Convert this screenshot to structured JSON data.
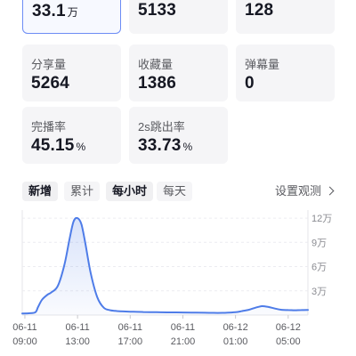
{
  "stats": {
    "top_row": [
      {
        "value": "33.1",
        "unit": "万"
      },
      {
        "value": "5133",
        "unit": ""
      },
      {
        "value": "128",
        "unit": ""
      }
    ],
    "row2": [
      {
        "label": "分享量",
        "value": "5264",
        "unit": ""
      },
      {
        "label": "收藏量",
        "value": "1386",
        "unit": ""
      },
      {
        "label": "弹幕量",
        "value": "0",
        "unit": ""
      }
    ],
    "row3": [
      {
        "label": "完播率",
        "value": "45.15",
        "unit": "%"
      },
      {
        "label": "2s跳出率",
        "value": "33.73",
        "unit": "%"
      }
    ]
  },
  "tabs": {
    "metric": [
      {
        "label": "新增",
        "active": true
      },
      {
        "label": "累计",
        "active": false
      }
    ],
    "granularity": [
      {
        "label": "每小时",
        "active": true
      },
      {
        "label": "每天",
        "active": false
      }
    ]
  },
  "settings_link": "设置观测",
  "colors": {
    "accent": "#4e7ce8",
    "selected_border": "#6c8cf5",
    "card_bg": "#f5f5f7"
  },
  "chart_data": {
    "type": "area",
    "y_ticks": [
      "12万",
      "9万",
      "6万",
      "3万"
    ],
    "y_tick_values": [
      120000,
      90000,
      60000,
      30000
    ],
    "ylim": [
      0,
      130000
    ],
    "x_tick_labels": [
      [
        "06-11",
        "09:00"
      ],
      [
        "06-11",
        "13:00"
      ],
      [
        "06-11",
        "17:00"
      ],
      [
        "06-11",
        "21:00"
      ],
      [
        "06-12",
        "01:00"
      ],
      [
        "06-12",
        "05:00"
      ]
    ],
    "x_tick_hours": [
      0,
      4,
      8,
      12,
      16,
      20
    ],
    "x_range_hours": [
      -0.2,
      21.5
    ],
    "series": [
      {
        "x": [
          -0.2,
          0.3,
          0.8,
          1.0,
          1.3,
          1.7,
          2.0,
          2.5,
          3.0,
          3.4,
          3.7,
          4.0,
          4.3,
          4.6,
          5.0,
          5.5,
          6.0,
          6.5,
          7.0,
          7.5,
          8.0,
          9.0,
          10.0,
          11.0,
          12.0,
          13.0,
          14.0,
          15.0,
          16.0,
          16.5,
          17.0,
          17.5,
          18.0,
          18.5,
          19.0,
          19.5,
          20.0,
          20.5,
          21.0,
          21.5
        ],
        "y": [
          2000,
          2200,
          3500,
          10000,
          19000,
          25000,
          28000,
          36000,
          62000,
          95000,
          116000,
          120000,
          112000,
          88000,
          52000,
          22000,
          9000,
          6000,
          5000,
          4500,
          4200,
          3800,
          3500,
          3300,
          3200,
          3000,
          2800,
          2700,
          3500,
          5000,
          6500,
          9000,
          11000,
          10000,
          8000,
          6500,
          6200,
          6000,
          6200,
          6400
        ]
      }
    ]
  }
}
